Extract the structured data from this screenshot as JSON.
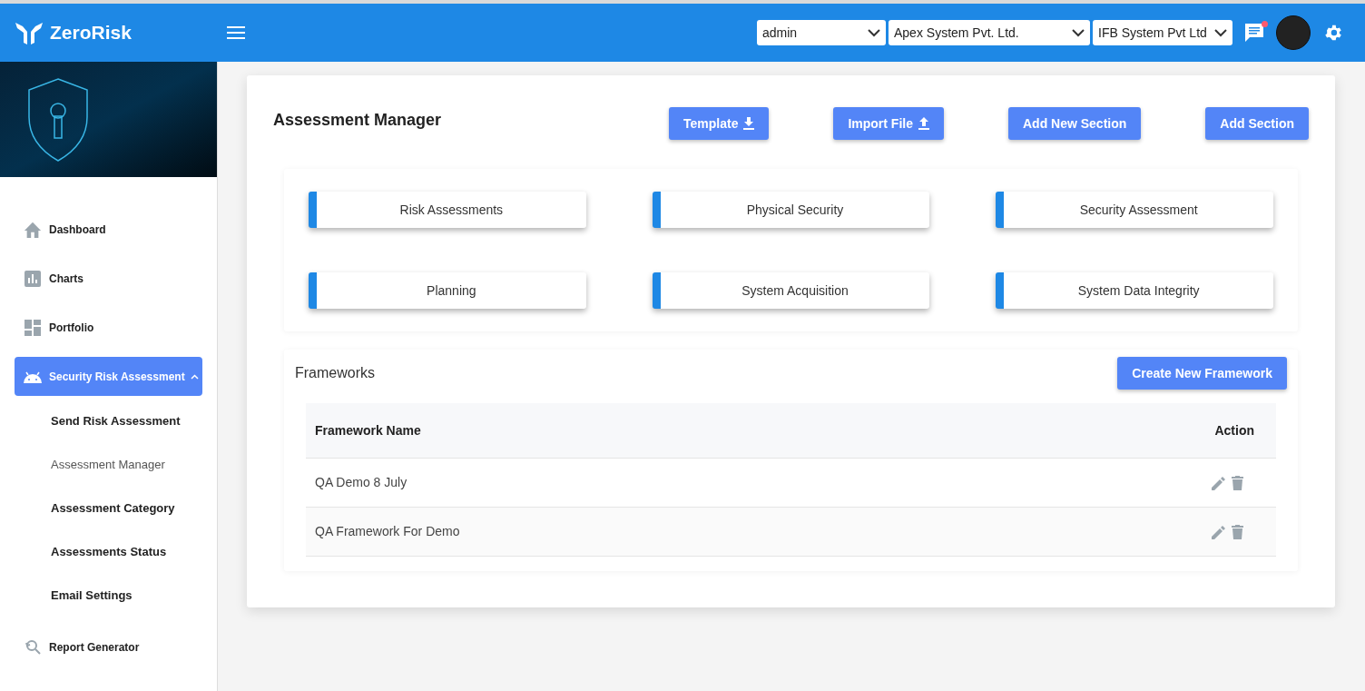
{
  "header": {
    "brand": "ZeroRisk",
    "selects": [
      {
        "value": "admin"
      },
      {
        "value": "Apex System Pvt. Ltd."
      },
      {
        "value": "IFB System Pvt Ltd"
      }
    ]
  },
  "sidebar": {
    "items": [
      {
        "label": "Dashboard",
        "kind": "home",
        "selected": false
      },
      {
        "label": "Charts",
        "kind": "chart",
        "selected": false
      },
      {
        "label": "Portfolio",
        "kind": "grid",
        "selected": false
      },
      {
        "label": "Security Risk Assessment",
        "kind": "android",
        "selected": true,
        "expanded": true,
        "children": [
          {
            "label": "Send Risk Assessment",
            "selected": false
          },
          {
            "label": "Assessment Manager",
            "selected": true
          },
          {
            "label": "Assessment Category",
            "selected": false
          },
          {
            "label": "Assessments Status",
            "selected": false
          },
          {
            "label": "Email Settings",
            "selected": false
          }
        ]
      },
      {
        "label": "Report Generator",
        "kind": "search",
        "selected": false
      }
    ]
  },
  "page": {
    "title": "Assessment Manager",
    "buttons": [
      {
        "label": "Template",
        "kind": "download"
      },
      {
        "label": "Import File",
        "kind": "upload"
      },
      {
        "label": "Add New Section",
        "kind": "plain"
      },
      {
        "label": "Add Section",
        "kind": "plain"
      }
    ],
    "sections": [
      "Risk Assessments",
      "Physical Security",
      "Security Assessment",
      "Planning",
      "System Acquisition",
      "System Data Integrity"
    ]
  },
  "frameworks": {
    "title": "Frameworks",
    "button": "Create New Framework",
    "columns": [
      "Framework Name",
      "Action"
    ],
    "rows": [
      {
        "name": "QA Demo 8 July"
      },
      {
        "name": "QA Framework For Demo"
      }
    ]
  }
}
